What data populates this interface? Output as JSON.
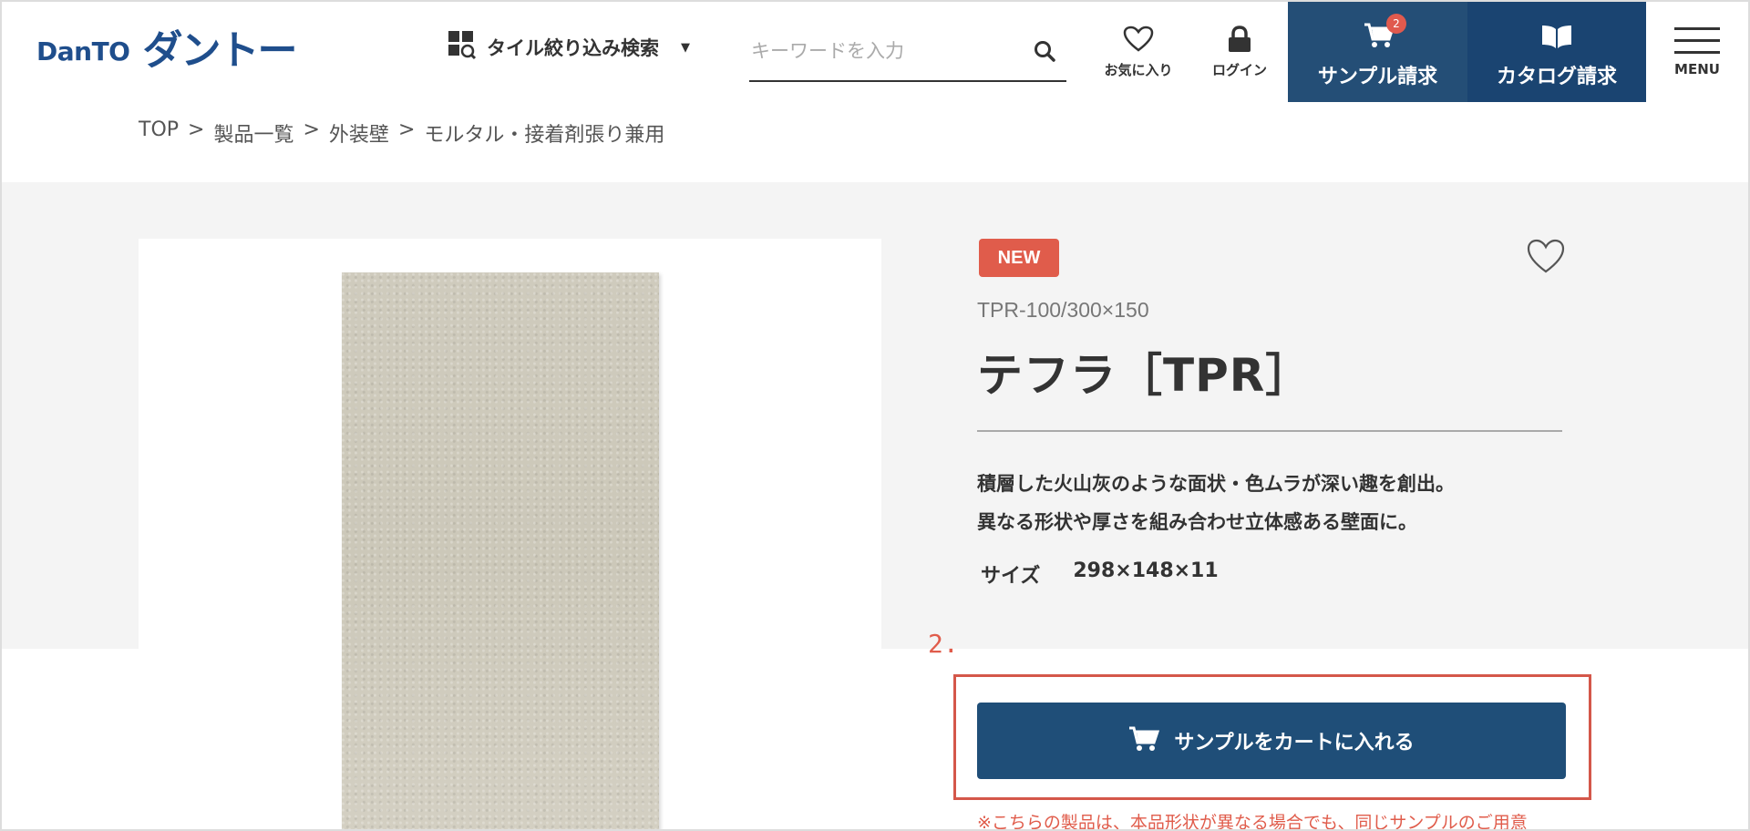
{
  "header": {
    "logo_latin": "DanTO",
    "logo_kana": "ダントー",
    "filter_label": "タイル絞り込み検索",
    "search_placeholder": "キーワードを入力",
    "favorites_label": "お気に入り",
    "login_label": "ログイン",
    "sample_request_label": "サンプル請求",
    "cart_count": "2",
    "catalog_request_label": "カタログ請求",
    "menu_label": "MENU"
  },
  "breadcrumb": [
    "TOP",
    "製品一覧",
    "外装壁",
    "モルタル・接着剤張り兼用"
  ],
  "breadcrumb_sep": ">",
  "product": {
    "badge": "NEW",
    "code": "TPR-100/300×150",
    "title": "テフラ［TPR］",
    "description": [
      "積層した火山灰のような面状・色ムラが深い趣を創出。",
      "異なる形状や厚さを組み合わせ立体感ある壁面に。"
    ],
    "size_label": "サイズ",
    "size_value": "298×148×11"
  },
  "annotation": {
    "step": "2."
  },
  "actions": {
    "add_to_cart_label": "サンプルをカートに入れる",
    "note": "※こちらの製品は、本品形状が異なる場合でも、同じサンプルのご用意"
  },
  "colors": {
    "brand_navy": "#1f4e78",
    "accent_red": "#e05c4b",
    "band_gray": "#f4f4f4"
  }
}
